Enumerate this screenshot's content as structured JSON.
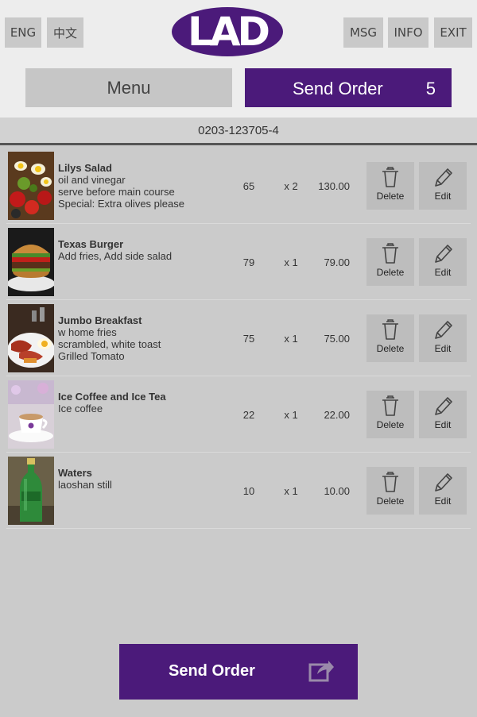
{
  "header": {
    "lang_en": "ENG",
    "lang_zh": "中文",
    "msg": "MSG",
    "info": "INFO",
    "exit": "EXIT",
    "logo_text": "LAD"
  },
  "tabs": {
    "menu": "Menu",
    "send_order": "Send Order",
    "item_count": "5"
  },
  "order_number": "0203-123705-4",
  "actions": {
    "delete": "Delete",
    "edit": "Edit"
  },
  "items": [
    {
      "name": "Lilys Salad",
      "notes": [
        "oil and vinegar",
        "serve before main course",
        "Special: Extra olives please"
      ],
      "price": "65",
      "qty": "x 2",
      "total": "130.00",
      "image": "salad-photo"
    },
    {
      "name": "Texas Burger",
      "notes": [
        "Add fries, Add side salad"
      ],
      "price": "79",
      "qty": "x 1",
      "total": "79.00",
      "image": "burger-photo"
    },
    {
      "name": "Jumbo Breakfast",
      "notes": [
        "w home fries",
        "scrambled, white toast",
        "Grilled Tomato"
      ],
      "price": "75",
      "qty": "x 1",
      "total": "75.00",
      "image": "breakfast-photo"
    },
    {
      "name": "Ice Coffee and Ice Tea",
      "notes": [
        "Ice coffee"
      ],
      "price": "22",
      "qty": "x 1",
      "total": "22.00",
      "image": "coffee-photo"
    },
    {
      "name": "Waters",
      "notes": [
        "laoshan still"
      ],
      "price": "10",
      "qty": "x 1",
      "total": "10.00",
      "image": "water-bottle-photo"
    }
  ],
  "footer": {
    "send_order": "Send Order"
  },
  "colors": {
    "accent": "#4b1a7a",
    "button_gray": "#c6c6c6",
    "background": "#cbcbcb"
  }
}
